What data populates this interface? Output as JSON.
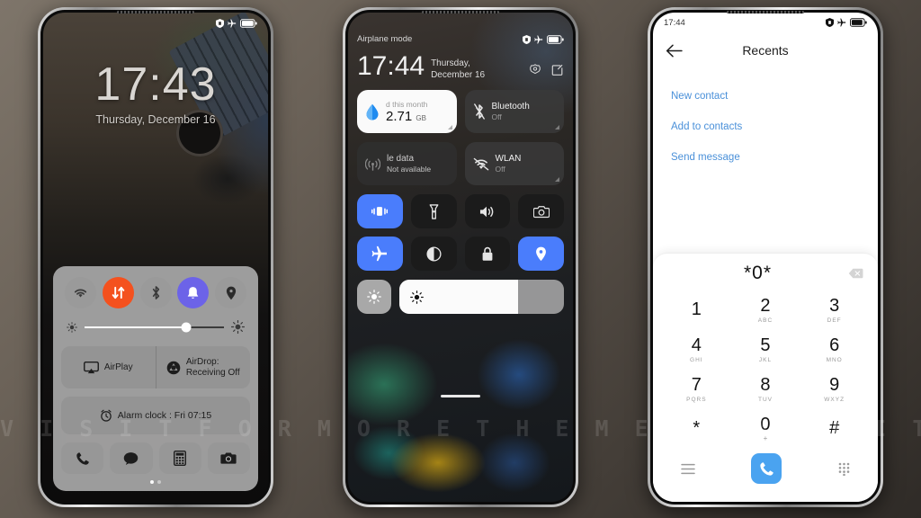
{
  "watermark": "V I S I T   F O R   M O R E   T H E M E S   -   M I U I T H E M E R . C O M",
  "phone1": {
    "status": {
      "time": "",
      "icons": [
        "shield-icon",
        "airplane-icon",
        "battery-icon"
      ]
    },
    "lockscreen": {
      "time": "17:43",
      "date": "Thursday, December 16"
    },
    "control_center": {
      "toggles": [
        {
          "name": "wifi",
          "state": "off"
        },
        {
          "name": "mobile-data",
          "state": "on"
        },
        {
          "name": "bluetooth",
          "state": "off"
        },
        {
          "name": "ring",
          "state": "on"
        },
        {
          "name": "location",
          "state": "off"
        }
      ],
      "brightness_percent": 73,
      "airplay_label": "AirPlay",
      "airdrop_label": "AirDrop:",
      "airdrop_sub": "Receiving Off",
      "alarm_label": "Alarm clock : Fri 07:15",
      "shortcuts": [
        "phone-icon",
        "messages-icon",
        "calculator-icon",
        "camera-icon"
      ],
      "page_dots": 2
    }
  },
  "phone2": {
    "status_text": "Airplane mode",
    "time": "17:44",
    "date": "Thursday, December 16",
    "actions": [
      "settings-gear-icon",
      "edit-icon"
    ],
    "big_tiles": [
      {
        "title": "d this month",
        "value": "2.71",
        "unit": "GB",
        "icon": "data-droplet-icon",
        "style": "light"
      },
      {
        "title": "Bluetooth",
        "sub": "Off",
        "icon": "bluetooth-off-icon",
        "style": "dark"
      },
      {
        "title": "le data",
        "sub": "Not available",
        "icon": "mobile-data-icon",
        "style": "dark"
      },
      {
        "title": "WLAN",
        "sub": "Off",
        "icon": "wifi-off-icon",
        "style": "dark"
      }
    ],
    "quick_tiles": [
      {
        "name": "vibrate-icon",
        "active": true
      },
      {
        "name": "flashlight-icon",
        "active": false
      },
      {
        "name": "volume-icon",
        "active": false
      },
      {
        "name": "camera-icon",
        "active": false
      },
      {
        "name": "airplane-icon",
        "active": true
      },
      {
        "name": "dark-mode-icon",
        "active": false
      },
      {
        "name": "lock-icon",
        "active": false
      },
      {
        "name": "location-icon",
        "active": true
      }
    ],
    "brightness_percent": 72
  },
  "phone3": {
    "status_time": "17:44",
    "title": "Recents",
    "links": [
      "New contact",
      "Add to contacts",
      "Send message"
    ],
    "number": "*0*",
    "keys": [
      {
        "digit": "1",
        "letters": ""
      },
      {
        "digit": "2",
        "letters": "ABC"
      },
      {
        "digit": "3",
        "letters": "DEF"
      },
      {
        "digit": "4",
        "letters": "GHI"
      },
      {
        "digit": "5",
        "letters": "JKL"
      },
      {
        "digit": "6",
        "letters": "MNO"
      },
      {
        "digit": "7",
        "letters": "PQRS"
      },
      {
        "digit": "8",
        "letters": "TUV"
      },
      {
        "digit": "9",
        "letters": "WXYZ"
      },
      {
        "digit": "*",
        "letters": ""
      },
      {
        "digit": "0",
        "letters": "+"
      },
      {
        "digit": "#",
        "letters": ""
      }
    ],
    "bottom": [
      "menu-icon",
      "call-button",
      "keypad-icon"
    ],
    "accent_color": "#4aa3f0",
    "link_color": "#4a90d9"
  }
}
